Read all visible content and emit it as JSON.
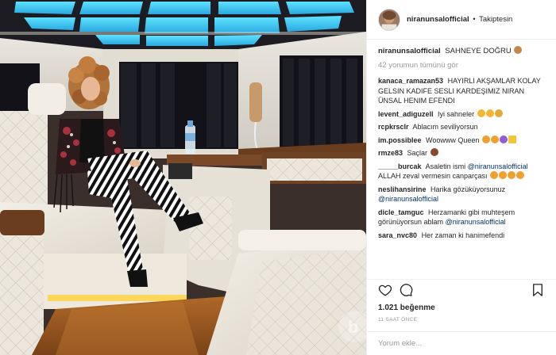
{
  "photo": {
    "description_icon": "limousine-interior-photo",
    "watermark": "b"
  },
  "header": {
    "username": "niranunsalofficial",
    "separator": "•",
    "follow_status": "Takiptesin"
  },
  "caption": {
    "username": "niranunsalofficial",
    "text": "SAHNEYE DOĞRU"
  },
  "view_all_comments": "42 yorumun tümünü gör",
  "comments": [
    {
      "user": "kanaca_ramazan53",
      "text": "HAYIRLI AKŞAMLAR KOLAY GELSIN KADIFE SESLI KARDEŞIMIZ NIRAN ÜNSAL HENIM EFENDI"
    },
    {
      "user": "levent_adiguzell",
      "text": "Iyi sahneler"
    },
    {
      "user": "rcpkrsclr",
      "text": "Ablacım seviliyorsun"
    },
    {
      "user": "im.possiblee",
      "text": "Woowww Queen"
    },
    {
      "user": "rmze83",
      "text": "Saçlar"
    },
    {
      "user": "_____burcak",
      "text": "Asaletin ismi",
      "mention": "@niranunsalofficial",
      "text2": "ALLAH zeval vermesin canparçası"
    },
    {
      "user": "neslihansirine",
      "text": "Harika gözüküyorsunuz",
      "mention": "@niranunsalofficial"
    },
    {
      "user": "dicle_tamguc",
      "text": "Herzamanki gibi muhteşem görünüyorsun ablam",
      "mention": "@niranunsalofficial"
    },
    {
      "user": "sara_nvc80",
      "text": "Her zaman ki hanimefendi"
    }
  ],
  "actions": {
    "like_icon": "heart-icon",
    "comment_icon": "comment-icon",
    "save_icon": "bookmark-icon"
  },
  "likes": "1.021 beğenme",
  "timestamp": "11 SAAT ÖNCE",
  "add_comment_placeholder": "Yorum ekle...",
  "colors": {
    "link": "#003569",
    "muted": "#999999",
    "border": "#efefef",
    "ceiling_light": "#4fd8ff",
    "floor_light": "#ffd23a"
  }
}
